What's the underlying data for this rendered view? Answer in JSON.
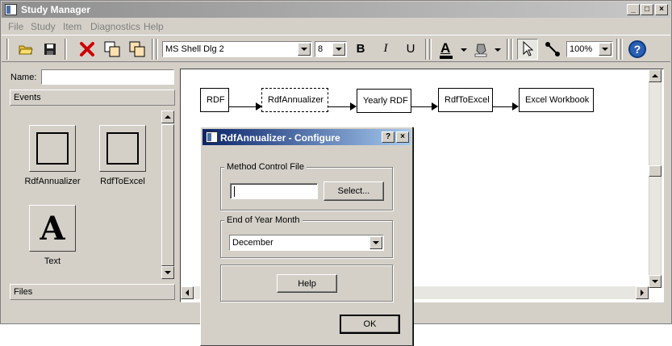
{
  "window": {
    "title": "Study Manager"
  },
  "menu": [
    "File",
    "Study",
    "Item",
    "Diagnostics",
    "Help"
  ],
  "toolbar": {
    "font_name": "MS Shell Dlg 2",
    "font_size": "8",
    "bold": "B",
    "italic": "I",
    "underline": "U",
    "font_color_letter": "A",
    "zoom": "100%",
    "help_glyph": "?"
  },
  "left_panel": {
    "name_label": "Name:",
    "name_value": "",
    "events_header": "Events",
    "files_header": "Files",
    "tools": [
      {
        "label": "RdfAnnualizer"
      },
      {
        "label": "RdfToExcel"
      },
      {
        "label": "Text",
        "glyph": "A"
      }
    ]
  },
  "canvas": {
    "nodes": [
      "RDF",
      "RdfAnnualizer",
      "Yearly RDF",
      "RdfToExcel",
      "Excel Workbook"
    ],
    "selected": "RdfAnnualizer"
  },
  "dialog": {
    "title": "RdfAnnualizer - Configure",
    "help_glyph": "?",
    "close_glyph": "×",
    "method_group": "Method Control File",
    "method_value": "",
    "select_button": "Select...",
    "month_group": "End of Year Month",
    "month_value": "December",
    "help_button": "Help",
    "ok_button": "OK"
  },
  "colors": {
    "face": "#d4d0c8",
    "title_active": "#0a246a",
    "delete_red": "#cc0000",
    "help_blue": "#2a5fb4"
  }
}
